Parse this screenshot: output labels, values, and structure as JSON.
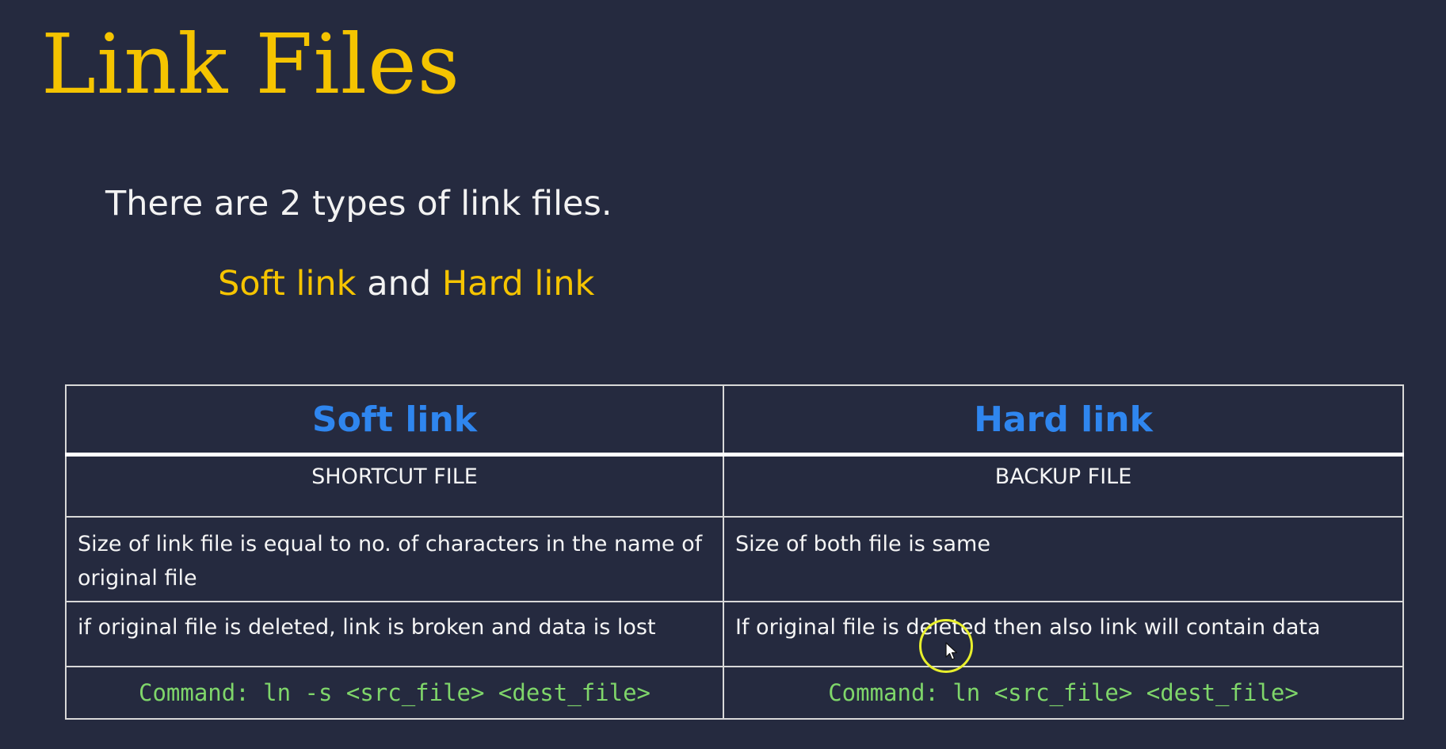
{
  "slide": {
    "title": "Link Files",
    "intro": "There are 2 types of link files.",
    "types_line": {
      "soft": "Soft link",
      "conjunction": " and ",
      "hard": "Hard link"
    }
  },
  "table": {
    "headers": [
      "Soft link",
      "Hard link"
    ],
    "rows": [
      [
        "SHORTCUT FILE",
        "BACKUP FILE"
      ],
      [
        "Size of link file is equal to no. of characters in the name of original file",
        "Size of both file is same"
      ],
      [
        "if original file is deleted, link is broken and data is lost",
        "If original file is deleted then also link will contain data"
      ],
      [
        "Command: ln -s <src_file> <dest_file>",
        "Command: ln <src_file> <dest_file>"
      ]
    ]
  },
  "colors": {
    "background": "#252a3f",
    "title": "#f5c400",
    "header": "#2f86ef",
    "command": "#7fd66a",
    "cursor_highlight": "#e8ef2c"
  },
  "icons": {
    "cursor": "mouse-pointer-icon"
  }
}
